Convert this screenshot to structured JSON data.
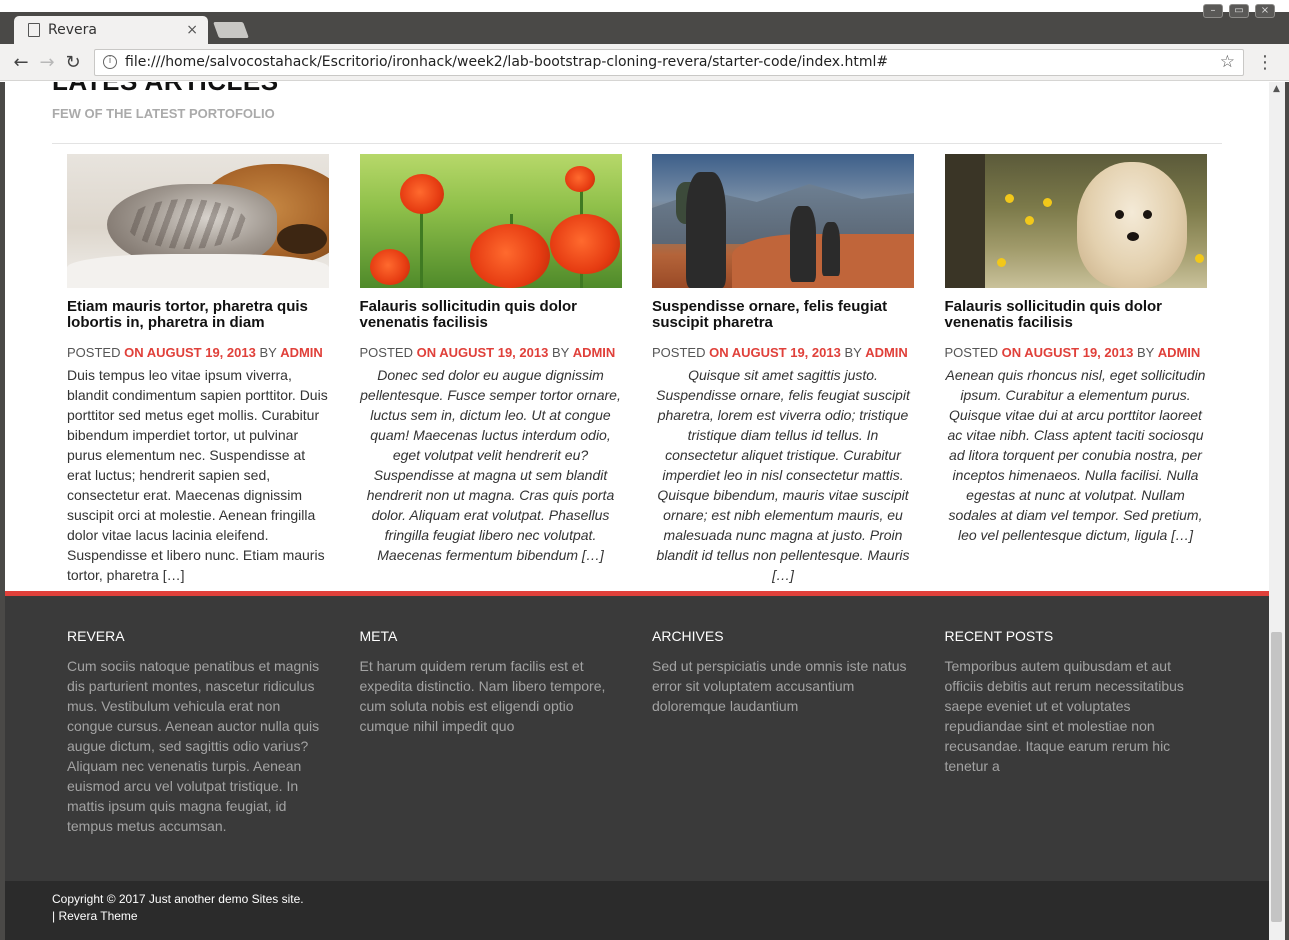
{
  "browser": {
    "tab_title": "Revera",
    "tab_close": "×",
    "url": "file:///home/salvocostahack/Escritorio/ironhack/week2/lab-bootstrap-cloning-revera/starter-code/index.html#",
    "back": "←",
    "forward": "→",
    "reload": "↻",
    "info": "i",
    "star": "☆",
    "menu": "⋮"
  },
  "section": {
    "title": "LATES ARTICLES",
    "subtitle": "FEW OF THE LATEST PORTOFOLIO"
  },
  "articles": [
    {
      "title": "Etiam mauris tortor, pharetra quis lobortis in, pharetra in diam",
      "posted": "POSTED",
      "date": "ON AUGUST 19, 2013",
      "by": "BY",
      "author": "ADMIN",
      "excerpt": "Duis tempus leo vitae ipsum viverra, blandit condimentum sapien porttitor. Duis porttitor sed metus eget mollis. Curabitur bibendum imperdiet tortor, ut pulvinar purus elementum nec. Suspendisse at erat luctus; hendrerit sapien sed, consectetur erat. Maecenas dignissim suscipit orci at molestie. Aenean fringilla dolor vitae lacus lacinia eleifend. Suspendisse et libero nunc. Etiam mauris tortor, pharetra […]",
      "image": "kitten-and-puppy-photo"
    },
    {
      "title": "Falauris sollicitudin quis dolor venenatis facilisis",
      "posted": "POSTED",
      "date": "ON AUGUST 19, 2013",
      "by": "BY",
      "author": "ADMIN",
      "excerpt": "Donec sed dolor eu augue dignissim pellentesque. Fusce semper tortor ornare, luctus sem in, dictum leo. Ut at congue quam! Maecenas luctus interdum odio, eget volutpat velit hendrerit eu? Suspendisse at magna ut sem blandit hendrerit non ut magna. Cras quis porta dolor. Aliquam erat volutpat. Phasellus fringilla feugiat libero nec volutpat. Maecenas fermentum bibendum […]",
      "image": "poppies-photo"
    },
    {
      "title": "Suspendisse ornare, felis feugiat suscipit pharetra",
      "posted": "POSTED",
      "date": "ON AUGUST 19, 2013",
      "by": "BY",
      "author": "ADMIN",
      "excerpt": "Quisque sit amet sagittis justo. Suspendisse ornare, felis feugiat suscipit pharetra, lorem est viverra odio; tristique tristique diam tellus id tellus. In consectetur aliquet tristique. Curabitur imperdiet leo in nisl consectetur mattis. Quisque bibendum, mauris vitae suscipit ornare; est nibh elementum mauris, eu malesuada nunc magna at justo. Proin blandit id tellus non pellentesque. Mauris […]",
      "image": "hikers-photo"
    },
    {
      "title": "Falauris sollicitudin quis dolor venenatis facilisis",
      "posted": "POSTED",
      "date": "ON AUGUST 19, 2013",
      "by": "BY",
      "author": "ADMIN",
      "excerpt": "Aenean quis rhoncus nisl, eget sollicitudin ipsum. Curabitur a elementum purus. Quisque vitae dui at arcu porttitor laoreet ac vitae nibh. Class aptent taciti sociosqu ad litora torquent per conubia nostra, per inceptos himenaeos. Nulla facilisi. Nulla egestas at nunc at volutpat. Nullam sodales at diam vel tempor. Sed pretium, leo vel pellentesque dictum, ligula […]",
      "image": "puppy-photo"
    }
  ],
  "footer": {
    "columns": [
      {
        "heading": "REVERA",
        "text": "Cum sociis natoque penatibus et magnis dis parturient montes, nascetur ridiculus mus. Vestibulum vehicula erat non congue cursus. Aenean auctor nulla quis augue dictum, sed sagittis odio varius? Aliquam nec venenatis turpis. Aenean euismod arcu vel volutpat tristique. In mattis ipsum quis magna feugiat, id tempus metus accumsan."
      },
      {
        "heading": "META",
        "text": "Et harum quidem rerum facilis est et expedita distinctio. Nam libero tempore, cum soluta nobis est eligendi optio cumque nihil impedit quo"
      },
      {
        "heading": "ARCHIVES",
        "text": "Sed ut perspiciatis unde omnis iste natus error sit voluptatem accusantium doloremque laudantium"
      },
      {
        "heading": "RECENT POSTS",
        "text": "Temporibus autem quibusdam et aut officiis debitis aut rerum necessitatibus saepe eveniet ut et voluptates repudiandae sint et molestiae non recusandae. Itaque earum rerum hic tenetur a"
      }
    ],
    "copyright": "Copyright © 2017 Just another demo Sites site.",
    "theme": "| Revera Theme"
  },
  "colors": {
    "accent": "#e0403a",
    "footer_bg": "#3a3a3a",
    "bottom_bar_bg": "#2b2b2b"
  }
}
